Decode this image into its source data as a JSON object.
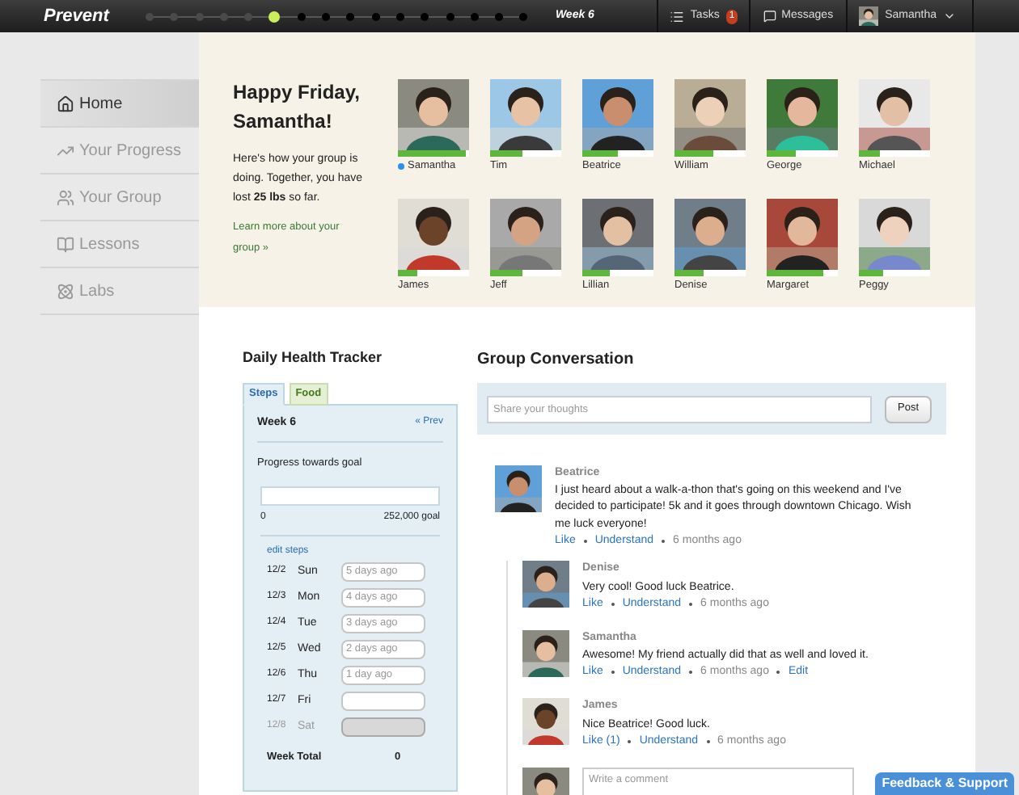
{
  "top_bar": {
    "logo": "Prevent",
    "timeline": [
      {
        "done": true,
        "current": false
      },
      {
        "done": true,
        "current": false
      },
      {
        "done": true,
        "current": false
      },
      {
        "done": true,
        "current": false
      },
      {
        "done": true,
        "current": false
      },
      {
        "done": false,
        "current": true
      },
      {
        "done": false,
        "current": false
      },
      {
        "done": false,
        "current": false
      },
      {
        "done": false,
        "current": false
      },
      {
        "done": false,
        "current": false
      },
      {
        "done": false,
        "current": false
      },
      {
        "done": false,
        "current": false
      },
      {
        "done": false,
        "current": false
      },
      {
        "done": false,
        "current": false
      },
      {
        "done": false,
        "current": false
      },
      {
        "done": false,
        "current": false
      }
    ],
    "week": "Week 6",
    "tasks": {
      "label": "Tasks",
      "count": "1"
    },
    "messages": "Messages",
    "user": "Samantha"
  },
  "sidebar": {
    "items": [
      {
        "label": "Home",
        "selected": true
      },
      {
        "label": "Your Progress",
        "selected": false
      },
      {
        "label": "Your Group",
        "selected": false
      },
      {
        "label": "Lessons",
        "selected": false
      },
      {
        "label": "Labs",
        "selected": false
      }
    ]
  },
  "greeting": {
    "title": "Happy Friday, Samantha!",
    "text": "Here's how your group is doing. Together, you have lost **25 lbs** so far.",
    "link": "Learn more about your group »"
  },
  "members": [
    {
      "name": "Samantha",
      "online": true,
      "level": 0.95
    },
    {
      "name": "Tim",
      "online": false,
      "level": 0.45
    },
    {
      "name": "Beatrice",
      "online": false,
      "level": 0.5
    },
    {
      "name": "William",
      "online": false,
      "level": 0.55
    },
    {
      "name": "George",
      "online": false,
      "level": 0.4
    },
    {
      "name": "Michael",
      "online": false,
      "level": 0.3
    },
    {
      "name": "James",
      "online": false,
      "level": 0.28
    },
    {
      "name": "Jeff",
      "online": false,
      "level": 0.45
    },
    {
      "name": "Lillian",
      "online": false,
      "level": 0.38
    },
    {
      "name": "Denise",
      "online": false,
      "level": 0.42
    },
    {
      "name": "Margaret",
      "online": false,
      "level": 0.8
    },
    {
      "name": "Peggy",
      "online": false,
      "level": 0.35
    }
  ],
  "tracker": {
    "title": "Daily Health Tracker",
    "tabs": [
      {
        "label": "Steps",
        "selected": true
      },
      {
        "label": "Food",
        "selected": false
      }
    ],
    "week": "Week 6",
    "prev": "« Prev",
    "progress_label": "Progress towards goal",
    "level": 0,
    "min": "0",
    "goal": "252,000 goal",
    "edit": "edit steps",
    "days": [
      {
        "date": "12/2",
        "day": "Sun",
        "placeholder": "5 days ago",
        "disabled": false
      },
      {
        "date": "12/3",
        "day": "Mon",
        "placeholder": "4 days ago",
        "disabled": false
      },
      {
        "date": "12/4",
        "day": "Tue",
        "placeholder": "3 days ago",
        "disabled": false
      },
      {
        "date": "12/5",
        "day": "Wed",
        "placeholder": "2 days ago",
        "disabled": false
      },
      {
        "date": "12/6",
        "day": "Thu",
        "placeholder": "1 day ago",
        "disabled": false
      },
      {
        "date": "12/7",
        "day": "Fri",
        "disabled": false
      },
      {
        "date": "12/8",
        "day": "Sat",
        "disabled": true
      }
    ],
    "total_label": "Week Total",
    "total": "0"
  },
  "conversation": {
    "title": "Group Conversation",
    "share": {
      "placeholder": "Share your thoughts",
      "button": "Post"
    },
    "post": {
      "author": "Beatrice",
      "text": "I just heard about a walk-a-thon that's going on this weekend and I've decided to participate! 5k and it goes through downtown Chicago. Wish me luck everyone!",
      "actions": [
        {
          "kind": "link",
          "label": "Like"
        },
        {
          "kind": "link",
          "label": "Understand"
        },
        {
          "kind": "time",
          "label": "6 months ago"
        }
      ],
      "replies": [
        {
          "author": "Denise",
          "text": "Very cool! Good luck Beatrice.",
          "actions": [
            {
              "kind": "link",
              "label": "Like"
            },
            {
              "kind": "link",
              "label": "Understand"
            },
            {
              "kind": "time",
              "label": "6 months ago"
            }
          ]
        },
        {
          "author": "Samantha",
          "text": "Awesome! My friend actually did that as well and loved it.",
          "actions": [
            {
              "kind": "link",
              "label": "Like"
            },
            {
              "kind": "link",
              "label": "Understand"
            },
            {
              "kind": "time",
              "label": "6 months ago"
            },
            {
              "kind": "link",
              "label": "Edit"
            }
          ]
        },
        {
          "author": "James",
          "text": "Nice Beatrice! Good luck.",
          "actions": [
            {
              "kind": "link",
              "label": "Like (1)"
            },
            {
              "kind": "link",
              "label": "Understand"
            },
            {
              "kind": "time",
              "label": "6 months ago"
            }
          ]
        }
      ]
    },
    "comment": {
      "placeholder": "Write a comment"
    }
  },
  "feedback": "Feedback & Support"
}
